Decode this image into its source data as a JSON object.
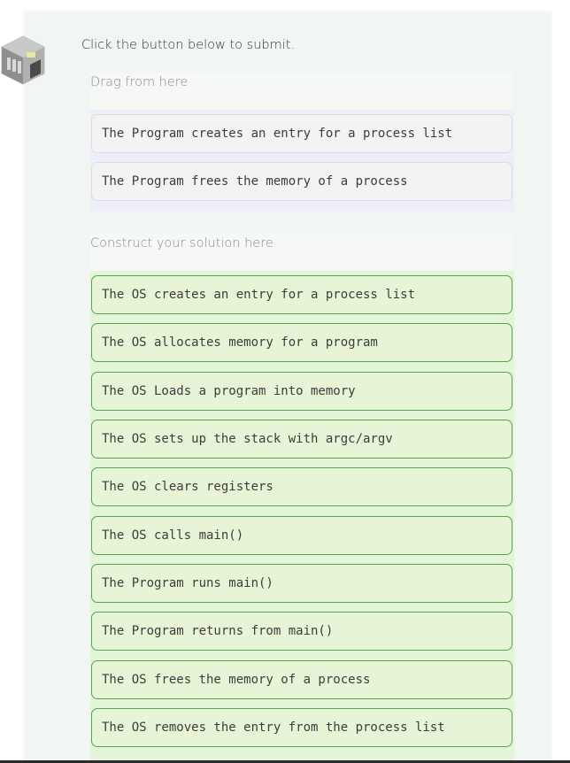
{
  "instructions": "Click the button below to submit.",
  "source": {
    "label": "Drag from here",
    "blocks": [
      "The Program creates an entry for a process list",
      "The Program frees the memory of a process"
    ]
  },
  "answer": {
    "label": "Construct your solution here",
    "blocks": [
      "The OS creates an entry for a process list",
      "The OS allocates memory for a program",
      "The OS Loads a program into memory",
      "The OS sets up the stack with argc/argv",
      "The OS clears registers",
      "The OS calls main()",
      "The Program runs main()",
      "The Program returns from main()",
      "The OS frees the memory of a process",
      "The OS removes the entry from the process list"
    ]
  },
  "colors": {
    "answer_border": "#4faa4f",
    "answer_bg": "#e4f4d9",
    "source_bg": "#eeeefa"
  }
}
